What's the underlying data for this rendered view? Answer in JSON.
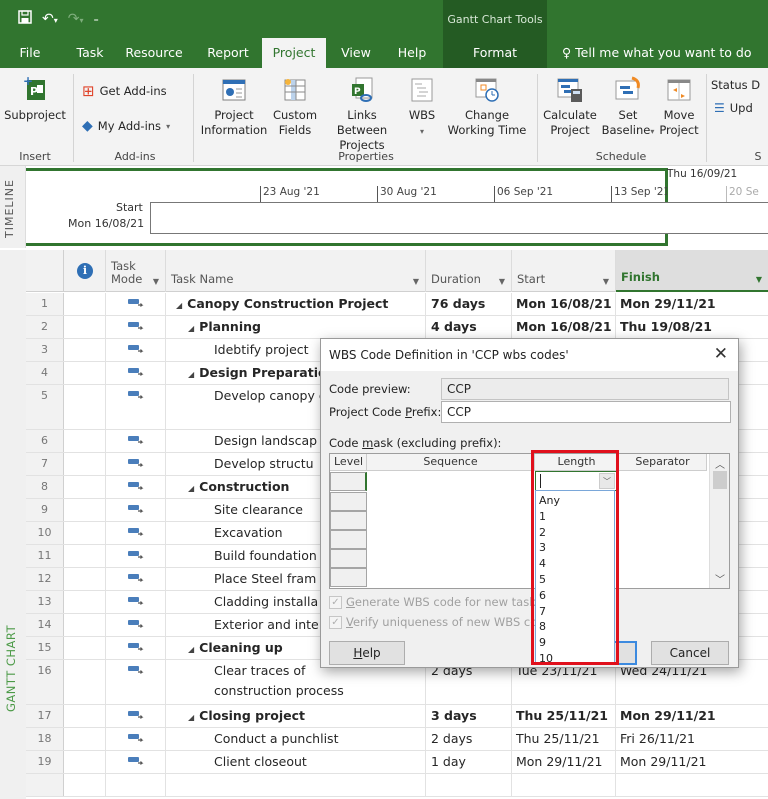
{
  "app": {
    "contextual_tab_group": "Gantt Chart Tools",
    "tell_me": "Tell me what you want to do"
  },
  "tabs": [
    {
      "label": "File",
      "active": false
    },
    {
      "label": "Task",
      "active": false
    },
    {
      "label": "Resource",
      "active": false
    },
    {
      "label": "Report",
      "active": false
    },
    {
      "label": "Project",
      "active": true
    },
    {
      "label": "View",
      "active": false
    },
    {
      "label": "Help",
      "active": false
    },
    {
      "label": "Format",
      "active": false
    }
  ],
  "ribbon": {
    "insert": {
      "group": "Insert",
      "subproject": "Subproject"
    },
    "addins": {
      "group": "Add-ins",
      "get_addins": "Get Add-ins",
      "my_addins": "My Add-ins"
    },
    "properties": {
      "group": "Properties",
      "project_information": [
        "Project",
        "Information"
      ],
      "custom_fields": [
        "Custom",
        "Fields"
      ],
      "links_between_projects": [
        "Links Between",
        "Projects"
      ],
      "wbs": "WBS",
      "change_working_time": [
        "Change",
        "Working Time"
      ]
    },
    "schedule": {
      "group": "Schedule",
      "calculate_project": [
        "Calculate",
        "Project"
      ],
      "set_baseline": [
        "Set",
        "Baseline"
      ],
      "move_project": [
        "Move",
        "Project"
      ]
    },
    "status": {
      "group": "S",
      "status_date": "Status D",
      "update": "Upd"
    }
  },
  "timeline": {
    "side_label": "TIMELINE",
    "start_label": "Start",
    "start_date": "Mon 16/08/21",
    "finish_date": "Thu 16/09/21",
    "ticks": [
      "23 Aug '21",
      "30 Aug '21",
      "06 Sep '21",
      "13 Sep '21",
      "20 Se"
    ]
  },
  "gantt": {
    "side_label": "GANTT CHART",
    "columns": {
      "info": "i",
      "task_mode": [
        "Task",
        "Mode"
      ],
      "task_name": "Task Name",
      "duration": "Duration",
      "start": "Start",
      "finish": "Finish"
    },
    "rows": [
      {
        "id": "1",
        "name": "Canopy Construction Project",
        "level": 0,
        "summary": true,
        "duration": "76 days",
        "start": "Mon 16/08/21",
        "finish": "Mon 29/11/21"
      },
      {
        "id": "2",
        "name": "Planning",
        "level": 1,
        "summary": true,
        "duration": "4 days",
        "start": "Mon 16/08/21",
        "finish": "Thu 19/08/21"
      },
      {
        "id": "3",
        "name": "Idebtify project",
        "level": 2,
        "summary": false,
        "duration": "",
        "start": "",
        "finish": ""
      },
      {
        "id": "4",
        "name": "Design Preparation",
        "level": 1,
        "summary": true,
        "duration": "",
        "start": "",
        "finish": ""
      },
      {
        "id": "5",
        "name": "Develop canopy design",
        "level": 2,
        "summary": false,
        "duration": "",
        "start": "",
        "finish": ""
      },
      {
        "id": "6",
        "name": "Design landscap",
        "level": 2,
        "summary": false,
        "duration": "",
        "start": "",
        "finish": ""
      },
      {
        "id": "7",
        "name": "Develop structu",
        "level": 2,
        "summary": false,
        "duration": "",
        "start": "",
        "finish": ""
      },
      {
        "id": "8",
        "name": "Construction",
        "level": 1,
        "summary": true,
        "duration": "",
        "start": "",
        "finish": ""
      },
      {
        "id": "9",
        "name": "Site clearance",
        "level": 2,
        "summary": false,
        "duration": "",
        "start": "",
        "finish": ""
      },
      {
        "id": "10",
        "name": "Excavation",
        "level": 2,
        "summary": false,
        "duration": "",
        "start": "",
        "finish": ""
      },
      {
        "id": "11",
        "name": "Build foundation",
        "level": 2,
        "summary": false,
        "duration": "",
        "start": "",
        "finish": ""
      },
      {
        "id": "12",
        "name": "Place Steel fram",
        "level": 2,
        "summary": false,
        "duration": "",
        "start": "",
        "finish": ""
      },
      {
        "id": "13",
        "name": "Cladding installa",
        "level": 2,
        "summary": false,
        "duration": "",
        "start": "",
        "finish": ""
      },
      {
        "id": "14",
        "name": "Exterior and inte",
        "level": 2,
        "summary": false,
        "duration": "",
        "start": "",
        "finish": ""
      },
      {
        "id": "15",
        "name": "Cleaning up",
        "level": 1,
        "summary": true,
        "duration": "",
        "start": "",
        "finish": ""
      },
      {
        "id": "16",
        "name": "Clear traces of construction process",
        "level": 2,
        "summary": false,
        "duration": "2 days",
        "start": "Tue 23/11/21",
        "finish": "Wed 24/11/21"
      },
      {
        "id": "17",
        "name": "Closing project",
        "level": 1,
        "summary": true,
        "duration": "3 days",
        "start": "Thu 25/11/21",
        "finish": "Mon 29/11/21"
      },
      {
        "id": "18",
        "name": "Conduct a punchlist",
        "level": 2,
        "summary": false,
        "duration": "2 days",
        "start": "Thu 25/11/21",
        "finish": "Fri 26/11/21"
      },
      {
        "id": "19",
        "name": "Client closeout",
        "level": 2,
        "summary": false,
        "duration": "1 day",
        "start": "Mon 29/11/21",
        "finish": "Mon 29/11/21"
      }
    ]
  },
  "dialog": {
    "title": "WBS Code Definition in 'CCP wbs codes'",
    "code_preview_label": "Code preview:",
    "code_preview_value": "CCP",
    "prefix_label_pre": "Project Code ",
    "prefix_label_ul": "P",
    "prefix_label_post": "refix:",
    "prefix_value": "CCP",
    "mask_label_pre": "Code ",
    "mask_label_ul": "m",
    "mask_label_post": "ask (excluding prefix):",
    "mask_columns": [
      "Level",
      "Sequence",
      "Length",
      "Separator"
    ],
    "length_value": "",
    "length_options": [
      "Any",
      "1",
      "2",
      "3",
      "4",
      "5",
      "6",
      "7",
      "8",
      "9",
      "10"
    ],
    "generate_ul": "G",
    "generate_rest": "enerate WBS code for new task",
    "generate_checked": true,
    "verify_ul": "V",
    "verify_rest": "erify uniqueness of new WBS cod",
    "verify_checked": true,
    "help_ul": "H",
    "help_rest": "elp",
    "ok_label": "",
    "cancel_label": "Cancel"
  },
  "colors": {
    "brand_green": "#31752f",
    "contextual_green": "#245b23",
    "highlight_red": "#e0101c",
    "task_mode_blue": "#4a7ebb"
  }
}
